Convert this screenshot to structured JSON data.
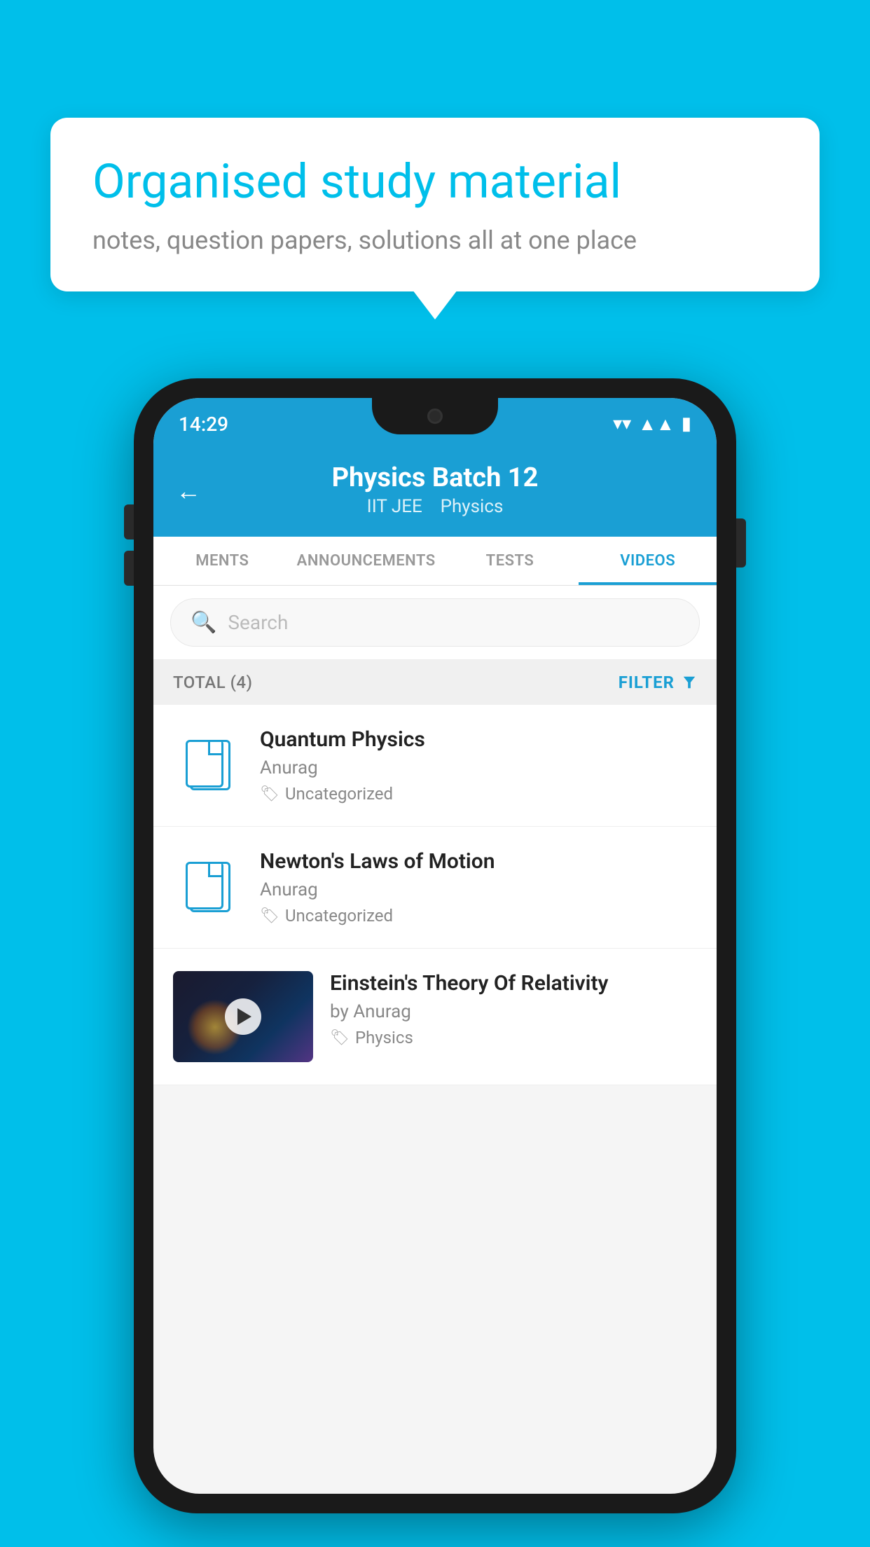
{
  "background_color": "#00BFEA",
  "speech_bubble": {
    "title": "Organised study material",
    "subtitle": "notes, question papers, solutions all at one place"
  },
  "status_bar": {
    "time": "14:29",
    "wifi": "▼",
    "signal": "▲",
    "battery": "▮"
  },
  "header": {
    "back_label": "←",
    "title": "Physics Batch 12",
    "subtitle_tag1": "IIT JEE",
    "subtitle_tag2": "Physics"
  },
  "tabs": [
    {
      "label": "MENTS",
      "active": false
    },
    {
      "label": "ANNOUNCEMENTS",
      "active": false
    },
    {
      "label": "TESTS",
      "active": false
    },
    {
      "label": "VIDEOS",
      "active": true
    }
  ],
  "search": {
    "placeholder": "Search"
  },
  "filter_bar": {
    "total_label": "TOTAL (4)",
    "filter_label": "FILTER"
  },
  "videos": [
    {
      "title": "Quantum Physics",
      "author": "Anurag",
      "tag": "Uncategorized",
      "has_thumbnail": false
    },
    {
      "title": "Newton's Laws of Motion",
      "author": "Anurag",
      "tag": "Uncategorized",
      "has_thumbnail": false
    },
    {
      "title": "Einstein's Theory Of Relativity",
      "author": "by Anurag",
      "tag": "Physics",
      "has_thumbnail": true
    }
  ]
}
